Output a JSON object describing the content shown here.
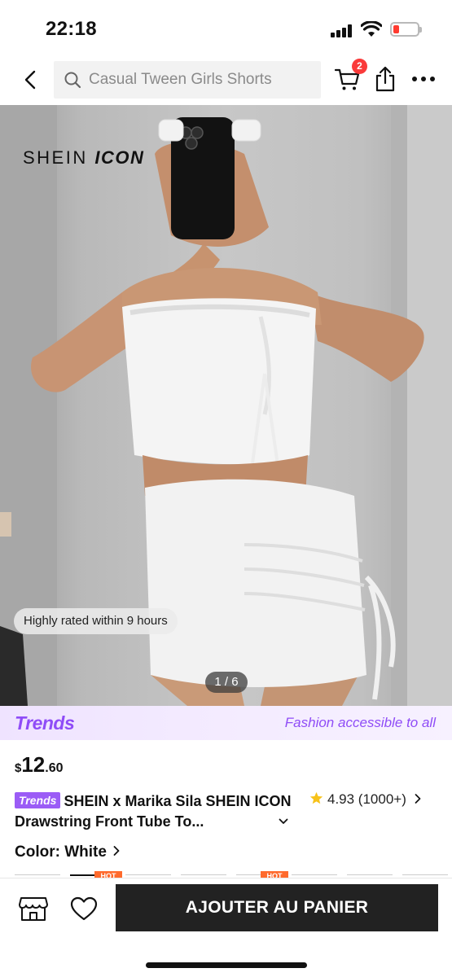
{
  "status_bar": {
    "time": "22:18"
  },
  "nav": {
    "search_placeholder": "Casual Tween Girls Shorts",
    "cart_count": "2"
  },
  "product_image": {
    "brand_logo_main": "SHEIN",
    "brand_logo_sub": "ICON",
    "highly_rated": "Highly rated within 9 hours",
    "counter": "1 / 6"
  },
  "trends_banner": {
    "logo": "Trends",
    "tagline": "Fashion accessible to all",
    "accent": "#8f4cf7"
  },
  "product": {
    "price_currency": "$",
    "price_integer": "12",
    "price_decimal": ".60",
    "trends_tag": "Trends",
    "title": "SHEIN x Marika Sila SHEIN ICON Drawstring Front Tube To...",
    "rating": "4.93 (1000+)",
    "color_label": "Color: White",
    "hot_tag": "HOT"
  },
  "bottom_bar": {
    "add_to_cart": "AJOUTER AU PANIER"
  },
  "colors": {
    "badge_red": "#fa3a3a",
    "star": "#f7c21a",
    "button_dark": "#222222",
    "hot_orange": "#ff6a2c"
  }
}
